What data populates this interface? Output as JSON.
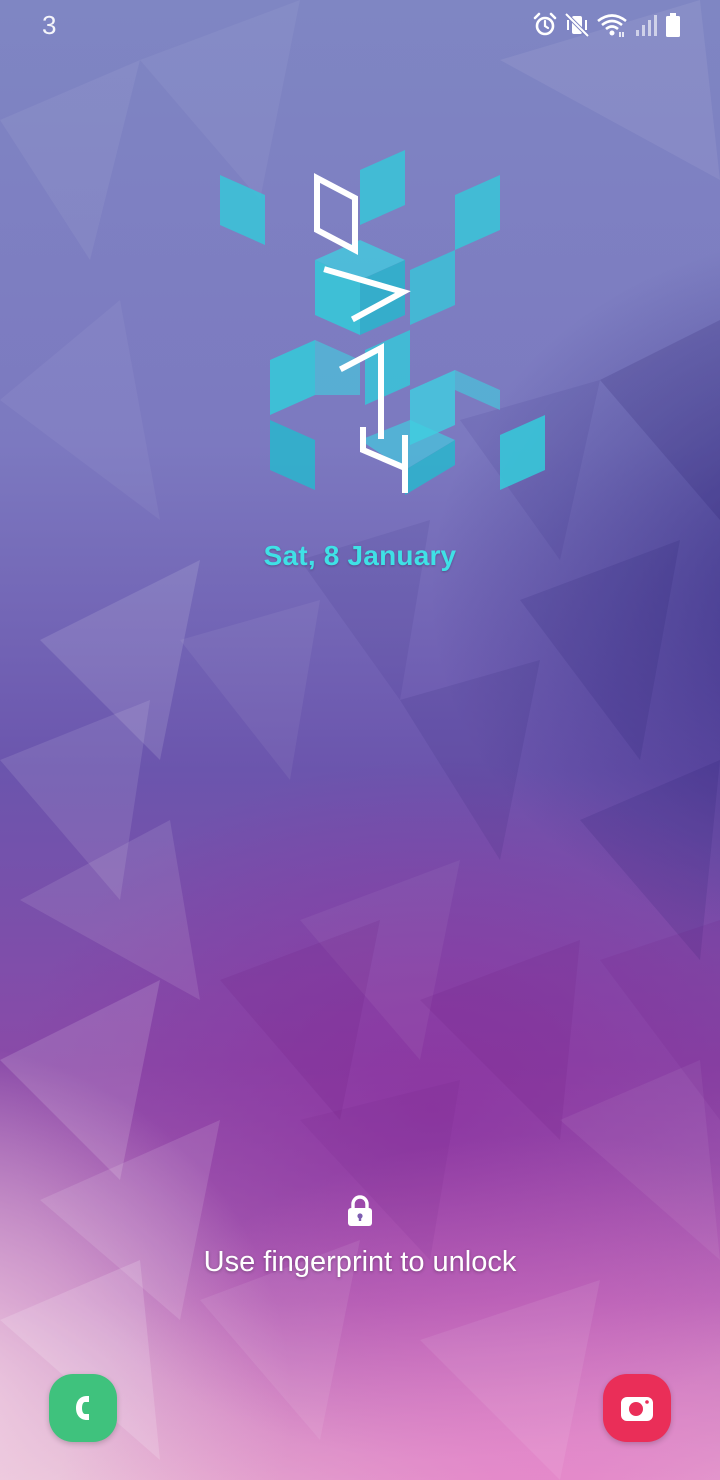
{
  "status_bar": {
    "notification_count": "3",
    "icons": [
      "alarm-icon",
      "vibrate-icon",
      "wifi-icon",
      "signal-icon",
      "battery-icon"
    ]
  },
  "clock": {
    "hour": "07",
    "minute": "14",
    "accent_color": "#37c6d8"
  },
  "date": "Sat, 8 January",
  "unlock_hint": "Use fingerprint to unlock",
  "shortcuts": {
    "left": {
      "icon": "phone-icon",
      "color": "#3fc27d"
    },
    "right": {
      "icon": "camera-icon",
      "color": "#ea2e58"
    }
  }
}
